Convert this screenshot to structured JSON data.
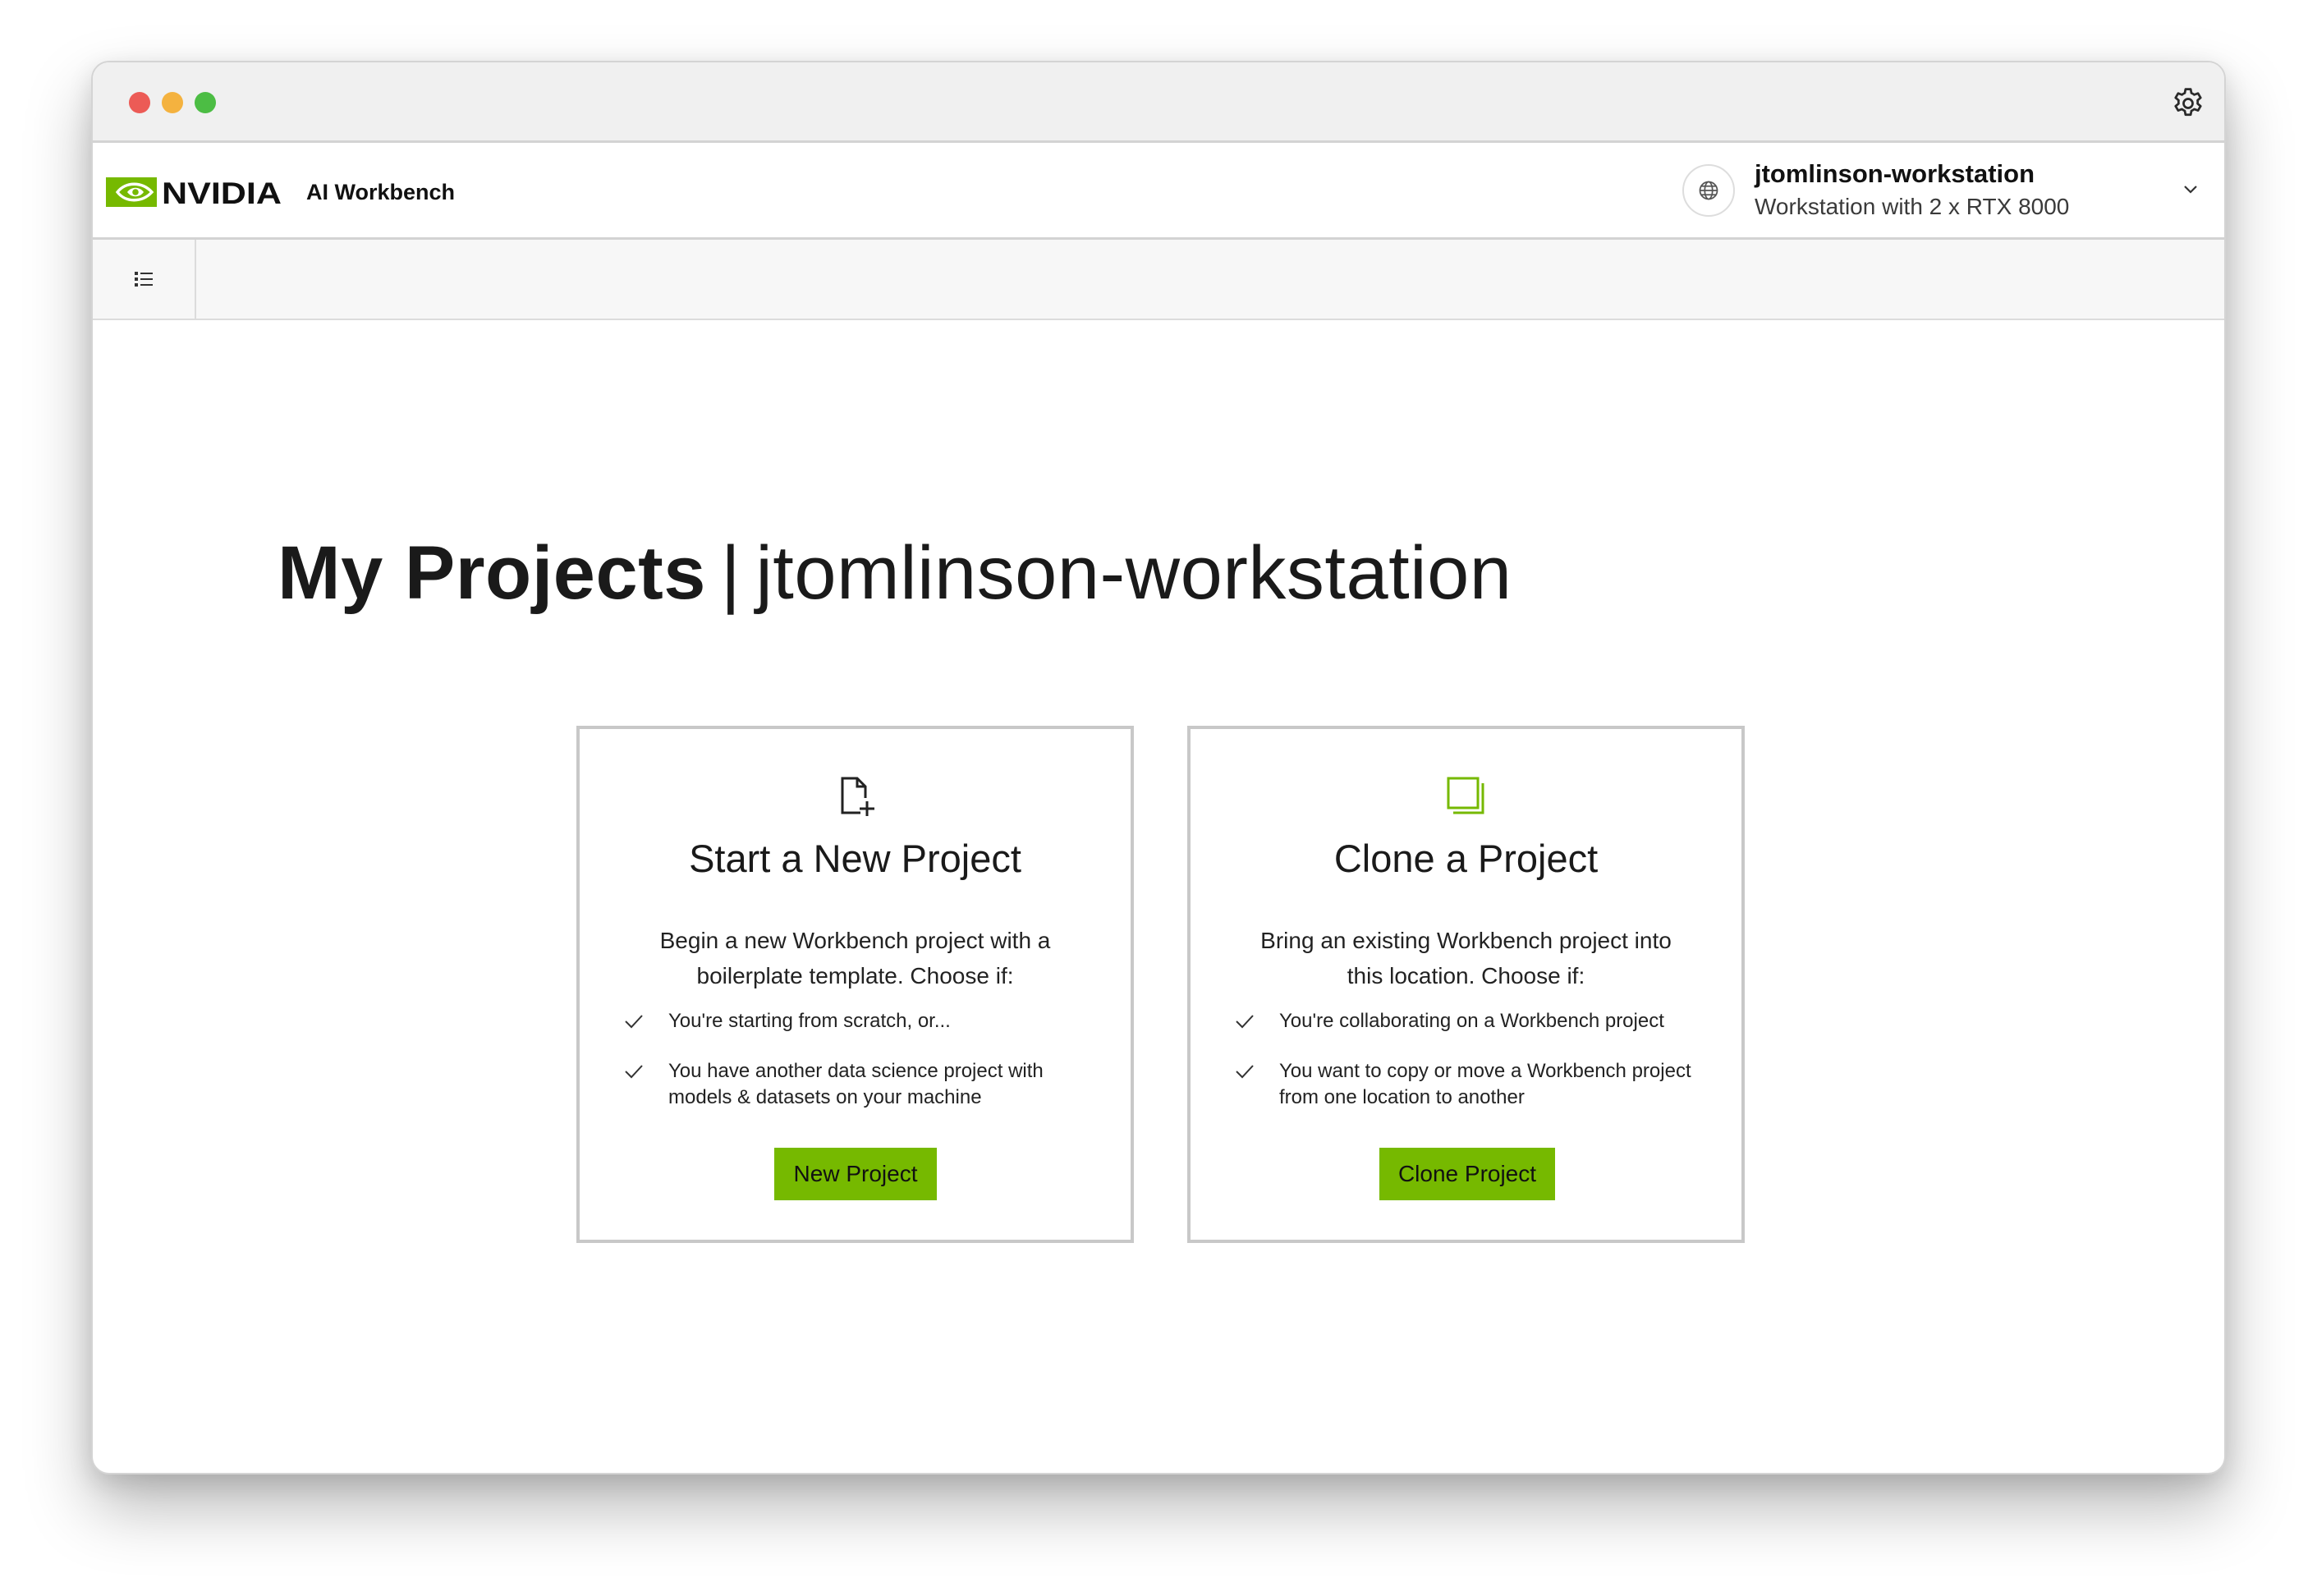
{
  "window": {
    "controls": [
      "close",
      "minimize",
      "maximize"
    ],
    "settings_icon": "gear-icon"
  },
  "header": {
    "brand": "NVIDIA",
    "product": "AI Workbench",
    "context": {
      "icon": "globe-icon",
      "name": "jtomlinson-workstation",
      "description": "Workstation with 2 x RTX 8000"
    }
  },
  "toolbar": {
    "toggle_icon": "list-icon"
  },
  "main": {
    "title": "My Projects",
    "separator": "|",
    "context": "jtomlinson-workstation"
  },
  "cards": [
    {
      "icon": "new-file-icon",
      "title": "Start a New Project",
      "description": "Begin a new Workbench project with a boilerplate template. Choose if:",
      "items": [
        "You're starting from scratch, or...",
        "You have another data science project with models & datasets on your machine"
      ],
      "button": "New Project"
    },
    {
      "icon": "clone-icon",
      "title": "Clone a Project",
      "description": "Bring an existing Workbench project into this location. Choose if:",
      "items": [
        "You're collaborating on a Workbench project",
        "You want to copy or move a Workbench project from one location to another"
      ],
      "button": "Clone Project"
    }
  ],
  "colors": {
    "accent": "#76b900",
    "close": "#ec5b56",
    "minimize": "#f4b23f",
    "maximize": "#4cbd44"
  }
}
